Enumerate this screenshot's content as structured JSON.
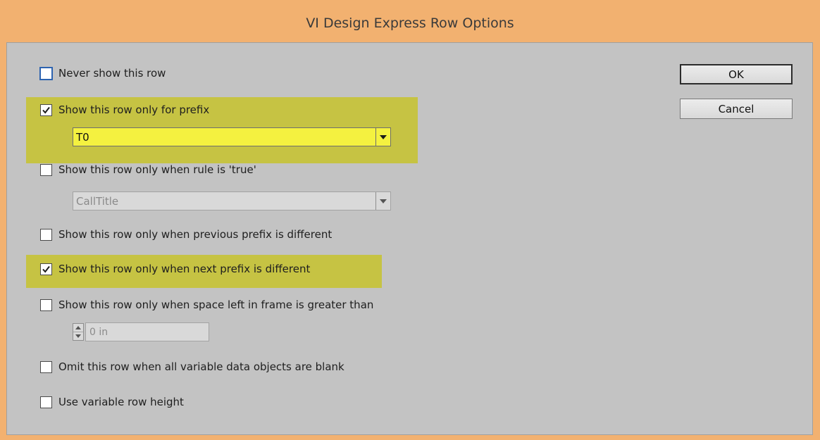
{
  "window": {
    "title": "VI Design Express Row Options",
    "frame_color": "#f2b170",
    "client_color": "#c3c3c3",
    "highlight_color": "#c6c343"
  },
  "options": {
    "never_show": {
      "label": "Never show this row",
      "checked": false
    },
    "prefix_only": {
      "label": "Show this row only for prefix",
      "checked": true
    },
    "prefix_dropdown": {
      "value": "T0",
      "enabled": true
    },
    "rule_true": {
      "label": "Show this row only when rule is 'true'",
      "checked": false
    },
    "rule_dropdown": {
      "value": "CallTitle",
      "enabled": false
    },
    "prev_prefix_different": {
      "label": "Show this row only when previous prefix is different",
      "checked": false
    },
    "next_prefix_different": {
      "label": "Show this row only when next prefix is different",
      "checked": true
    },
    "space_left": {
      "label": "Show this row only when space left in frame is greater than",
      "checked": false
    },
    "space_value": {
      "value": "0 in",
      "enabled": false
    },
    "omit_blank": {
      "label": "Omit this row when all variable data objects are blank",
      "checked": false
    },
    "variable_height": {
      "label": "Use variable row height",
      "checked": false
    }
  },
  "buttons": {
    "ok": "OK",
    "cancel": "Cancel"
  }
}
